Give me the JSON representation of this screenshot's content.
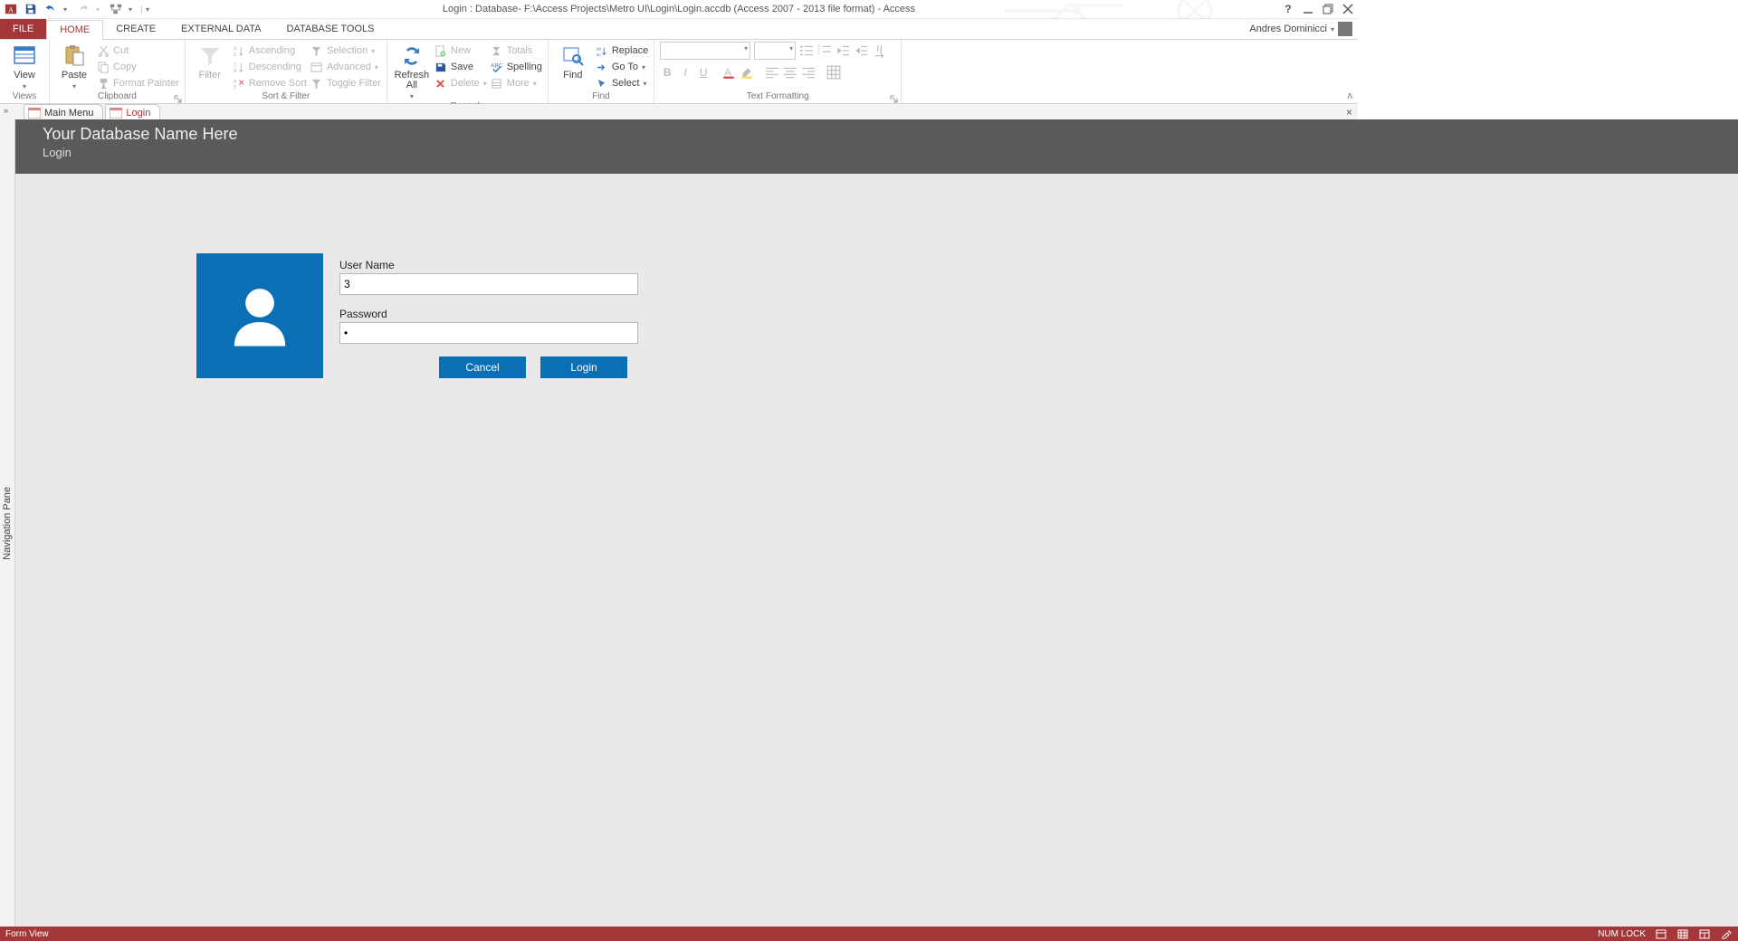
{
  "titlebar": {
    "title": "Login : Database- F:\\Access Projects\\Metro UI\\Login\\Login.accdb (Access 2007 - 2013 file format) - Access"
  },
  "user": {
    "name": "Andres Dominicci"
  },
  "ribbon_tabs": {
    "file": "FILE",
    "home": "HOME",
    "create": "CREATE",
    "external": "EXTERNAL DATA",
    "dbtools": "DATABASE TOOLS"
  },
  "ribbon": {
    "views": {
      "group": "Views",
      "view": "View"
    },
    "clipboard": {
      "group": "Clipboard",
      "paste": "Paste",
      "cut": "Cut",
      "copy": "Copy",
      "fmtpaint": "Format Painter"
    },
    "sortfilter": {
      "group": "Sort & Filter",
      "filter": "Filter",
      "asc": "Ascending",
      "desc": "Descending",
      "remove": "Remove Sort",
      "selection": "Selection",
      "advanced": "Advanced",
      "toggle": "Toggle Filter"
    },
    "records": {
      "group": "Records",
      "refresh": "Refresh\nAll",
      "new": "New",
      "save": "Save",
      "delete": "Delete",
      "totals": "Totals",
      "spelling": "Spelling",
      "more": "More"
    },
    "find": {
      "group": "Find",
      "find": "Find",
      "replace": "Replace",
      "goto": "Go To",
      "select": "Select"
    },
    "textfmt": {
      "group": "Text Formatting"
    }
  },
  "doctabs": {
    "main": "Main Menu",
    "login": "Login"
  },
  "navpane": {
    "label": "Navigation Pane"
  },
  "form": {
    "header_title": "Your Database Name Here",
    "header_sub": "Login",
    "username_lbl": "User Name",
    "username_val": "3",
    "password_lbl": "Password",
    "password_val": "•",
    "btn_cancel": "Cancel",
    "btn_login": "Login"
  },
  "statusbar": {
    "left": "Form View",
    "numlock": "NUM LOCK"
  }
}
